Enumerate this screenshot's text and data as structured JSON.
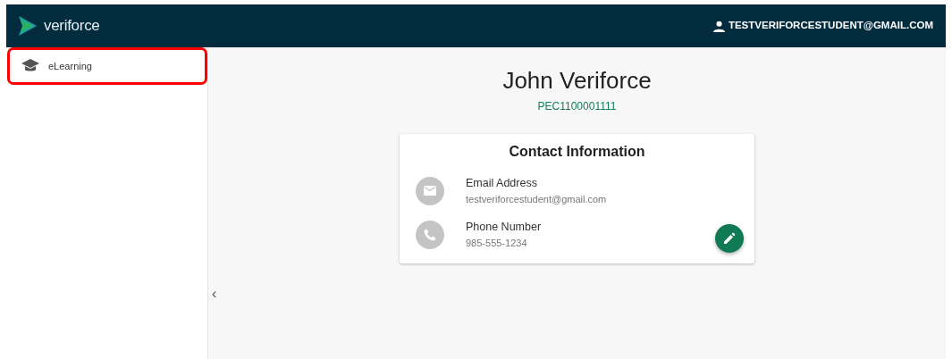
{
  "header": {
    "brand": "veriforce",
    "user": "TESTVERIFORCESTUDENT@GMAIL.COM"
  },
  "sidebar": {
    "items": [
      {
        "label": "eLearning",
        "highlighted": true
      }
    ],
    "collapse": "‹"
  },
  "profile": {
    "name": "John Veriforce",
    "id": "PEC1100001111"
  },
  "contact_card": {
    "title": "Contact Information",
    "rows": [
      {
        "kind": "email",
        "label": "Email Address",
        "value": "testveriforcestudent@gmail.com"
      },
      {
        "kind": "phone",
        "label": "Phone Number",
        "value": "985-555-1234"
      }
    ]
  }
}
